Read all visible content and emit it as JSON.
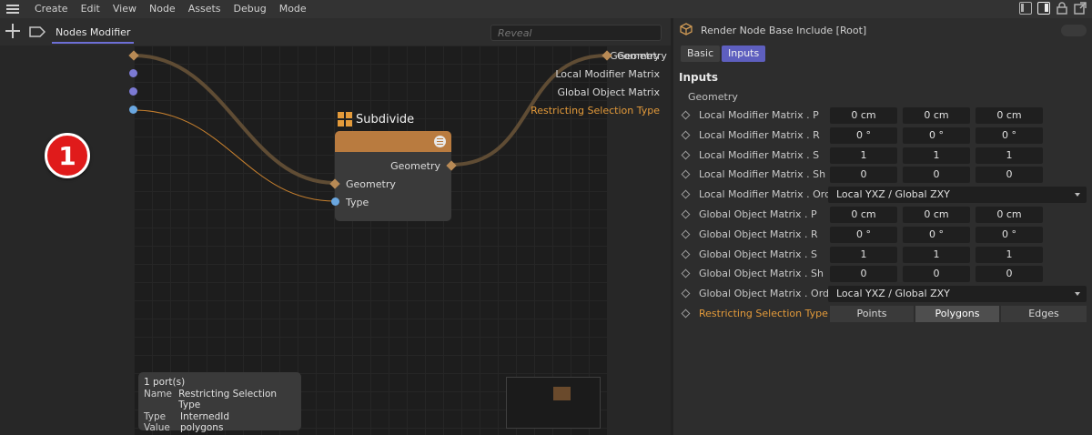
{
  "menubar": {
    "items": [
      "Create",
      "Edit",
      "View",
      "Node",
      "Assets",
      "Debug",
      "Mode"
    ]
  },
  "node_editor": {
    "tab_label": "Nodes Modifier",
    "reveal_placeholder": "Reveal",
    "input_ports": [
      "Geometry",
      "Local Modifier Matrix",
      "Global Object Matrix",
      "Restricting Selection Type"
    ],
    "output_port": "Geometry",
    "badge": "1",
    "node": {
      "title": "Subdivide",
      "output": "Geometry",
      "inputs": [
        "Geometry",
        "Type"
      ]
    },
    "tooltip": {
      "header": "1 port(s)",
      "rows": [
        {
          "key": "Name",
          "value": "Restricting Selection Type"
        },
        {
          "key": "Type",
          "value": "InternedId"
        },
        {
          "key": "Value",
          "value": "polygons"
        }
      ]
    }
  },
  "attributes": {
    "title": "Render Node Base Include [Root]",
    "tabs": [
      "Basic",
      "Inputs"
    ],
    "active_tab": "Inputs",
    "section": "Inputs",
    "subsection": "Geometry",
    "rows": [
      {
        "label": "Local Modifier Matrix . P",
        "values": [
          "0 cm",
          "0 cm",
          "0 cm"
        ]
      },
      {
        "label": "Local Modifier Matrix . R",
        "values": [
          "0 °",
          "0 °",
          "0 °"
        ]
      },
      {
        "label": "Local Modifier Matrix . S",
        "values": [
          "1",
          "1",
          "1"
        ]
      },
      {
        "label": "Local Modifier Matrix . Sh",
        "values": [
          "0",
          "0",
          "0"
        ]
      },
      {
        "label": "Local Modifier Matrix . Order",
        "dropdown": "Local YXZ / Global ZXY"
      },
      {
        "label": "Global Object Matrix . P",
        "values": [
          "0 cm",
          "0 cm",
          "0 cm"
        ]
      },
      {
        "label": "Global Object Matrix . R",
        "values": [
          "0 °",
          "0 °",
          "0 °"
        ]
      },
      {
        "label": "Global Object Matrix . S",
        "values": [
          "1",
          "1",
          "1"
        ]
      },
      {
        "label": "Global Object Matrix . Sh",
        "values": [
          "0",
          "0",
          "0"
        ]
      },
      {
        "label": "Global Object Matrix . Order",
        "dropdown": "Local YXZ / Global ZXY"
      },
      {
        "label": "Restricting Selection Type",
        "segments": [
          "Points",
          "Polygons",
          "Edges"
        ],
        "selected": "Polygons"
      }
    ]
  },
  "colors": {
    "accent": "#6d6fd6",
    "node_header": "#b97b3f",
    "active_port": "#e39a3a",
    "badge": "#e01b1b"
  }
}
